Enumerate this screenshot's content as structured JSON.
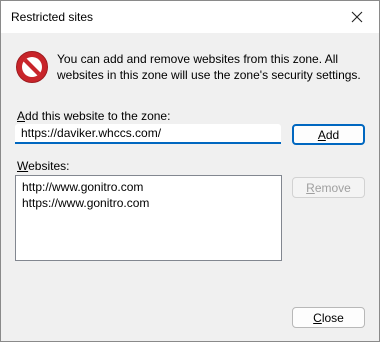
{
  "window": {
    "title": "Restricted sites",
    "close_glyph": "✕"
  },
  "info": {
    "icon": "no-entry-icon",
    "text": "You can add and remove websites from this zone. All websites in this zone will use the zone's security settings."
  },
  "add_section": {
    "label_accel": "A",
    "label_rest": "dd this website to the zone:",
    "input_value": "https://daviker.whccs.com/",
    "add_button_accel": "A",
    "add_button_rest": "dd"
  },
  "websites": {
    "label_accel": "W",
    "label_rest": "ebsites:",
    "items": [
      "http://www.gonitro.com",
      "https://www.gonitro.com"
    ],
    "remove_button_accel": "R",
    "remove_button_rest": "emove"
  },
  "footer": {
    "close_button_accel": "C",
    "close_button_rest": "lose"
  },
  "colors": {
    "accent": "#0067c0",
    "stop_red": "#c8242a"
  }
}
